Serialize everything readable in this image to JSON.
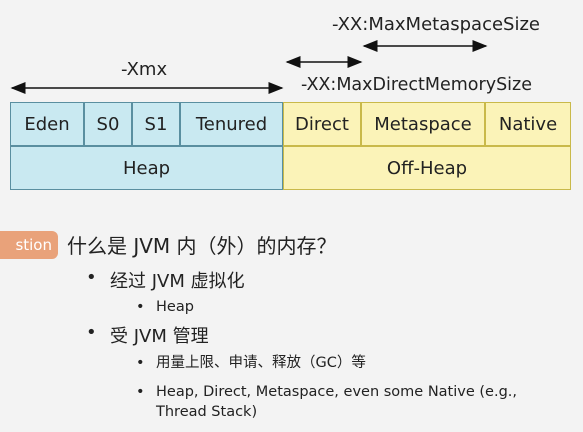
{
  "labels": {
    "max_metaspace": "-XX:MaxMetaspaceSize",
    "xmx": "-Xmx",
    "max_direct": "-XX:MaxDirectMemorySize"
  },
  "memory_row": [
    {
      "label": "Eden",
      "group": "heap"
    },
    {
      "label": "S0",
      "group": "heap"
    },
    {
      "label": "S1",
      "group": "heap"
    },
    {
      "label": "Tenured",
      "group": "heap"
    },
    {
      "label": "Direct",
      "group": "off-heap"
    },
    {
      "label": "Metaspace",
      "group": "off-heap"
    },
    {
      "label": "Native",
      "group": "off-heap"
    }
  ],
  "groups": {
    "heap": "Heap",
    "off_heap": "Off-Heap"
  },
  "colors": {
    "heap_fill": "#c9e9f1",
    "off_heap_fill": "#fbf3b8",
    "badge": "#e9a27a"
  },
  "question": {
    "badge": "stion",
    "text": "什么是 JVM 内（外）的内存？",
    "bullets": [
      {
        "text": "经过 JVM 虚拟化",
        "sub": [
          "Heap"
        ]
      },
      {
        "text": "受 JVM 管理",
        "sub": [
          "用量上限、申请、释放（GC）等",
          "Heap, Direct, Metaspace, even some Native (e.g.,",
          "Thread Stack)"
        ]
      }
    ]
  }
}
